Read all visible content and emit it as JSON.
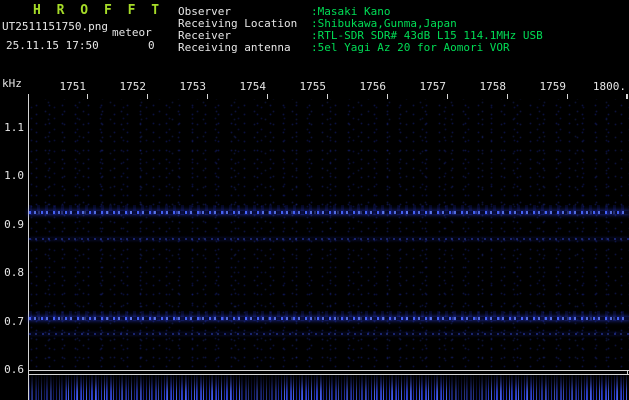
{
  "app": {
    "title": "H R O F F T"
  },
  "header": {
    "filename": "UT2511151750.png",
    "station": "meteor",
    "datetime": "25.11.15 17:50",
    "count": "0",
    "info": [
      {
        "label": "Observer",
        "value": ":Masaki Kano"
      },
      {
        "label": "Receiving Location",
        "value": ":Shibukawa,Gunma,Japan"
      },
      {
        "label": "Receiver",
        "value": ":RTL-SDR SDR# 43dB L15 114.1MHz USB"
      },
      {
        "label": "Receiving antenna",
        "value": ":5el Yagi Az 20 for Aomori VOR"
      }
    ]
  },
  "chart_data": {
    "type": "heatmap",
    "subtype": "radio-meteor-spectrogram",
    "ylabel": "kHz",
    "y_ticks": [
      "1.1",
      "1.0",
      "0.9",
      "0.8",
      "0.7",
      "0.6"
    ],
    "ylim": [
      0.6,
      1.16
    ],
    "x_ticks": [
      "1751",
      "1752",
      "1753",
      "1754",
      "1755",
      "1756",
      "1757",
      "1758",
      "1759",
      "1800."
    ],
    "x_axis": "UT time HHMM, window 17:50-18:00",
    "grid": false,
    "background": "#000000",
    "noise_color": "#1e2a96",
    "bands": [
      {
        "freq_khz": 0.93,
        "intensity": "strong",
        "appearance": "continuous dotted blue carrier line"
      },
      {
        "freq_khz": 0.87,
        "intensity": "weak",
        "appearance": "faint broken blue line"
      },
      {
        "freq_khz": 0.71,
        "intensity": "strong",
        "appearance": "continuous dotted blue carrier line"
      },
      {
        "freq_khz": 0.68,
        "intensity": "weak",
        "appearance": "faint broken blue line"
      }
    ],
    "bottom_panel": {
      "description": "signal-level strip of blue noise",
      "color": "#2c3ed0"
    }
  },
  "colors": {
    "background": "#000000",
    "title_green": "#a6dc28",
    "text_white": "#e6e6e6",
    "value_green": "#00dc55",
    "axis_white": "#d4d4d4",
    "noise_blue": "#2c3ed0"
  }
}
